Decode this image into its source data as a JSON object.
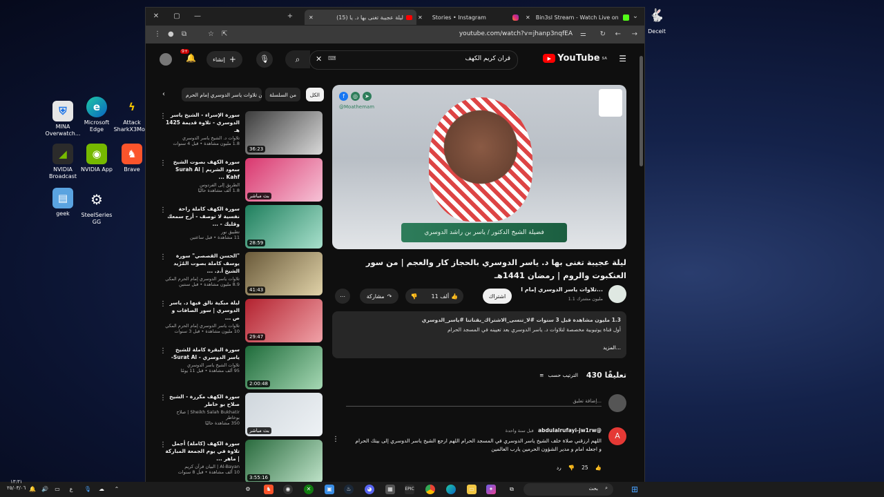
{
  "desktop": {
    "icons": [
      {
        "label": "MINA Overwatch...",
        "name": "mina-overwatch-icon"
      },
      {
        "label": "Microsoft Edge",
        "name": "edge-icon"
      },
      {
        "label": "Attack SharkX3Mo...",
        "name": "attack-shark-icon"
      },
      {
        "label": "NVIDIA Broadcast",
        "name": "nvidia-broadcast-icon"
      },
      {
        "label": "NVIDIA App",
        "name": "nvidia-app-icon"
      },
      {
        "label": "Brave",
        "name": "brave-icon"
      },
      {
        "label": "geek",
        "name": "geek-icon"
      },
      {
        "label": "SteelSeries GG",
        "name": "steelseries-icon"
      },
      {
        "label": "Deceit",
        "name": "deceit-icon"
      }
    ]
  },
  "browser": {
    "tabs": [
      {
        "title": "(15) ليلة عجيبة تغنى بها د. يا",
        "active": true
      },
      {
        "title": "Stories • Instagram",
        "active": false
      },
      {
        "title": "Bin3sl Stream - Watch Live on",
        "active": false
      }
    ],
    "url": "youtube.com/watch?v=jhanp3nqfEA"
  },
  "header": {
    "logo": "YouTube",
    "region": "SA",
    "search_query": "قران كريم الكهف",
    "create_label": "إنشاء",
    "notif_badge": "9+"
  },
  "video": {
    "title": "ليلة عجيبة تغنى بها د. ياسر الدوسري بالحجاز كار والعجم | من سور العنكبوت والروم | رمضان 1441هـ",
    "player_handle": "@Moathemam",
    "banner_text": "فضيلة الشيخ الدكتور / ياسر بن راشد الدوسري",
    "channel_name": "تلاوات ياسر الدوسري إمام ا...",
    "subscribers": "1.1 مليون مشترك",
    "subscribe_label": "اشتراك",
    "likes": "11 ألف",
    "share_label": "مشاركة",
    "views_line": "1.3 مليون مشاهدة  قبل 3 سنوات  #لا_تنسى_الاشتراك_بقناتنا #ياسر_الدوسري",
    "desc_line": "أول قناة يوتيوبية مخصصة لتلاوات د. ياسر الدوسري بعد تعيينه في المسجد الحرام",
    "more_label": "...المزيد"
  },
  "comments": {
    "count_label": "430 تعليقًا",
    "sort_label": "الترتيب حسب",
    "add_placeholder": "إضافة تعليق...",
    "items": [
      {
        "author": "@abdulalrufayi-jw1rw",
        "time": "قبل سنة واحدة",
        "avatar": "A",
        "text": "اللهم ارزقني صلاة خلف الشيخ ياسر الدوسري في المسجد الحرام اللهم ارجع الشيخ ياسر الدوسري إلى بيتك الحرام و اجعله امام و مدير الشؤون الحرمين يارب العالمين",
        "likes": "25",
        "reply_label": "رد"
      }
    ]
  },
  "sidebar": {
    "chips": [
      "الكل",
      "من السلسلة",
      "من تلاوات ياسر الدوسري إمام الحرم"
    ],
    "recs": [
      {
        "title": "سورة الإسراء - الشيخ ياسر الدوسري - تلاوة قديمة 1425 هـ",
        "channel": "تلاوات د. الشيخ ياسر الدوسري",
        "meta": "1.8 مليون مشاهدة • قبل 4 سنوات",
        "duration": "36:23",
        "c1": "#3c3c3c",
        "c2": "#d9d9d9"
      },
      {
        "title": "سورة الكهف بصوت الشيخ سعود الشريم | Surah Al Kahf ...",
        "channel": "الطريق إلى الفردوس",
        "meta": "1.8 ألف مشاهدة حاليًا",
        "duration": "بث مباشر",
        "c1": "#d9376e",
        "c2": "#f6c2d6"
      },
      {
        "title": "سورة الكهف كاملة راحة نفسية لا توصف - أرح سمعك وقلبك - ...",
        "channel": "تطبيق نور",
        "meta": "11 مشاهدة • قبل ساعتين",
        "duration": "28:59",
        "c1": "#1f7f5d",
        "c2": "#a8e0cc"
      },
      {
        "title": "\"الحسن القصصي\" سورة يوسف كاملة بصوت المُزَيد الشيخ أ.د. ...",
        "channel": "تلاوات ياسر الدوسري إمام الحرم المكي",
        "meta": "8.9 مليون مشاهدة • قبل سنتين",
        "duration": "41:43",
        "c1": "#6a5a3a",
        "c2": "#e0d2a8"
      },
      {
        "title": "ليلة مبكية تالق فيها د. ياسر الدوسري | سور الصافات و ص ...",
        "channel": "تلاوات ياسر الدوسري إمام الحرم المكي",
        "meta": "10 مليون مشاهدة • قبل 3 سنوات",
        "duration": "29:47",
        "c1": "#b3222f",
        "c2": "#f0a2a8"
      },
      {
        "title": "سورة البقرة كاملة للشيخ ياسر الدوسري - Surat Al-",
        "channel": "تلاوات الشيخ ياسر الدوسري",
        "meta": "95 ألف مشاهدة • قبل 11 يومًا",
        "duration": "2:00:48",
        "c1": "#1e6b3a",
        "c2": "#a6d8b4"
      },
      {
        "title": "سورة الكهف مكررة - الشيخ صلاح بو خاطر",
        "channel": "Sheikh Salah Bukhatir | صلاح بوخاطر",
        "meta": "350 مشاهدة حاليًا",
        "duration": "بث مباشر",
        "c1": "#cfd6dc",
        "c2": "#eef2f5"
      },
      {
        "title": "سورة الكهف (كاملة) أجمل تلاوة في يوم الجمعة المباركة | ماهر ...",
        "channel": "Al-Bayan | البيان قرآن كريم",
        "meta": "10 ألف مشاهدة • قبل 8 سنوات",
        "duration": "3:55:16",
        "c1": "#2a6b3e",
        "c2": "#bfe3c9"
      }
    ]
  },
  "taskbar": {
    "time": "١٣:٣١",
    "date": "٢٥/٠٣/٠٦",
    "search_label": "بحث",
    "lang": "ع"
  }
}
